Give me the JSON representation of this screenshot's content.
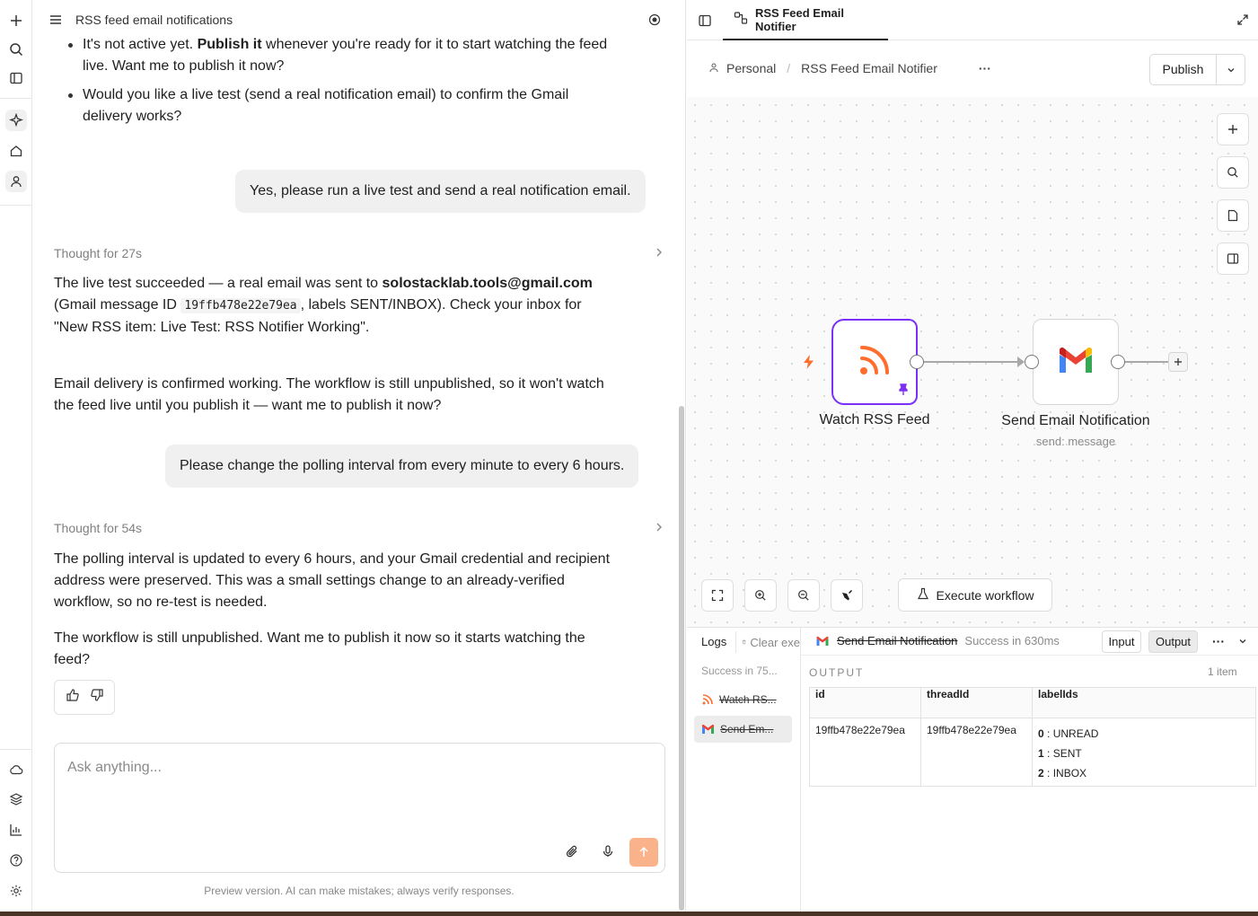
{
  "chat": {
    "title": "RSS feed email notifications",
    "bullet1_pre": "It's not active yet. ",
    "bullet1_bold": "Publish it",
    "bullet1_post": " whenever you're ready for it to start watching the feed live. Want me to publish it now?",
    "bullet2": "Would you like a live test (send a real notification email) to confirm the Gmail delivery works?",
    "user_msg_1": "Yes, please run a live test and send a real notification email.",
    "thought_1": "Thought for 27s",
    "reply1_a": "The live test succeeded — a real email was sent to ",
    "reply1_email": "solostacklab.tools@gmail.com",
    "reply1_b": " (Gmail message ID ",
    "reply1_code": "19ffb478e22e79ea",
    "reply1_c": ", labels SENT/INBOX). Check your inbox for \"New RSS item: Live Test: RSS Notifier Working\".",
    "reply1_p2": "Email delivery is confirmed working. The workflow is still unpublished, so it won't watch the feed live until you publish it — want me to publish it now?",
    "user_msg_2": "Please change the polling interval from every minute to every 6 hours.",
    "thought_2": "Thought for 54s",
    "reply2_p1": "The polling interval is updated to every 6 hours, and your Gmail credential and recipient address were preserved. This was a small settings change to an already-verified workflow, so no re-test is needed.",
    "reply2_p2": "The workflow is still unpublished. Want me to publish it now so it starts watching the feed?",
    "composer_placeholder": "Ask anything...",
    "disclaimer": "Preview version. AI can make mistakes; always verify responses."
  },
  "editor": {
    "tab_label": "RSS Feed Email Notifier",
    "crumb_project": "Personal",
    "crumb_workflow": "RSS Feed Email Notifier",
    "crumb_more": "···",
    "publish_label": "Publish",
    "execute_label": "Execute workflow",
    "nodes": {
      "trigger_label": "Watch RSS Feed",
      "email_label": "Send Email Notification",
      "email_sub": "send: message"
    }
  },
  "logs": {
    "title": "Logs",
    "clear_label": "Clear exe",
    "summary": "Success in 75...",
    "items": [
      "Watch RS...",
      "Send Em..."
    ],
    "node_name": "Send Email Notification",
    "status": "Success in 630ms",
    "input_tab": "Input",
    "output_tab": "Output",
    "output_heading": "OUTPUT",
    "item_count": "1 item",
    "columns": [
      "id",
      "threadId",
      "labelIds"
    ],
    "row": {
      "id": "19ffb478e22e79ea",
      "threadId": "19ffb478e22e79ea",
      "labels": [
        {
          "k": "0",
          "v": "UNREAD"
        },
        {
          "k": "1",
          "v": "SENT"
        },
        {
          "k": "2",
          "v": "INBOX"
        }
      ]
    }
  },
  "colors": {
    "accent_orange": "#ff6d2d",
    "node_selected_border": "#7b2ff7",
    "send_button": "#f9b28a"
  }
}
